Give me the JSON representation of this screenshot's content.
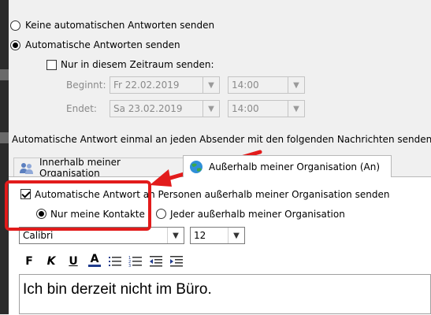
{
  "options": {
    "no_auto_replies": "Keine automatischen Antworten senden",
    "send_auto_replies": "Automatische Antworten senden",
    "time_range_label": "Nur in diesem Zeitraum senden:",
    "start_label": "Beginnt:",
    "end_label": "Endet:",
    "start_date": "Fr 22.02.2019",
    "start_time": "14:00",
    "end_date": "Sa 23.02.2019",
    "end_time": "14:00"
  },
  "info_text": "Automatische Antwort einmal an jeden Absender mit den folgenden Nachrichten senden:",
  "tabs": [
    {
      "label": "Innerhalb meiner Organisation",
      "icon": "people-icon",
      "active": false
    },
    {
      "label": "Außerhalb meiner Organisation (An)",
      "icon": "globe-icon",
      "active": true
    }
  ],
  "outside": {
    "send_outside_label": "Automatische Antwort an Personen außerhalb meiner Organisation senden",
    "only_contacts_label": "Nur meine Kontakte",
    "everyone_label": "Jeder außerhalb meiner Organisation"
  },
  "format": {
    "font": "Calibri",
    "size": "12",
    "bold": "F",
    "italic": "K",
    "underline": "U",
    "font_color": "A"
  },
  "message_text": "Ich bin derzeit nicht im Büro.",
  "annotation_color": "#e21b1b"
}
